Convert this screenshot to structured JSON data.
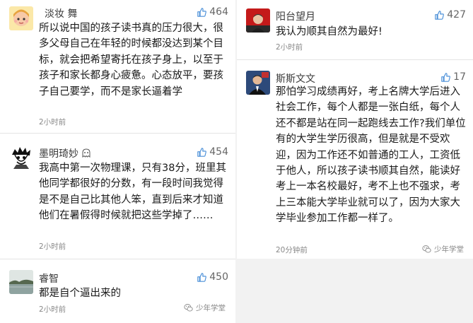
{
  "left_column": [
    {
      "author": "淡妆 舞",
      "likes": "464",
      "text": "所以说中国的孩子读书真的压力很大，很多父母自己在年轻的时候都没达到某个目标，就会把希望寄托在孩子身上，以至于孩子和家长都身心疲惫。心态放平，要孩子自己要学，而不是家长逼着学",
      "time": "2小时前",
      "avatar_icon": "cartoon-girl-avatar-icon"
    },
    {
      "author": "墨明琦妙",
      "likes": "454",
      "text": "我高中第一次物理课，只有38分，班里其他同学都很好的分数，有一段时间我觉得是不是自己比其他人笨，直到后来才知道他们在暑假得时候就把这些学掉了……",
      "time": "2小时前",
      "avatar_icon": "anime-sketch-avatar-icon"
    },
    {
      "author": "睿智",
      "likes": "450",
      "text": "都是自个逼出来的",
      "time": "2小时前",
      "avatar_icon": "landscape-avatar-icon"
    }
  ],
  "right_column": [
    {
      "author": "阳台望月",
      "likes": "427",
      "text": "我认为顺其自然为最好!",
      "time": "2小时前",
      "avatar_icon": "portrait-red-avatar-icon"
    },
    {
      "author": "斯斯文文",
      "likes": "17",
      "text": "那怕学习成绩再好，考上名牌大学后进入社会工作，每个人都是一张白纸，每个人还不都是站在同一起跑线去工作?我们单位有的大学生学历很高，但是就是不受欢迎，因为工作还不如普通的工人，工资低于他人，所以孩子读书顺其自然，能读好考上一本名校最好，考不上也不强求，考上三本能大学毕业就可以了，因为大家大学毕业参加工作都一样了。",
      "time": "20分钟前",
      "avatar_icon": "man-suit-avatar-icon"
    }
  ],
  "watermark": "少年学堂",
  "colors": {
    "like_icon": "#4a8fd8",
    "text": "#1a1a1a",
    "meta": "#888888",
    "background": "#f2f2f2"
  }
}
